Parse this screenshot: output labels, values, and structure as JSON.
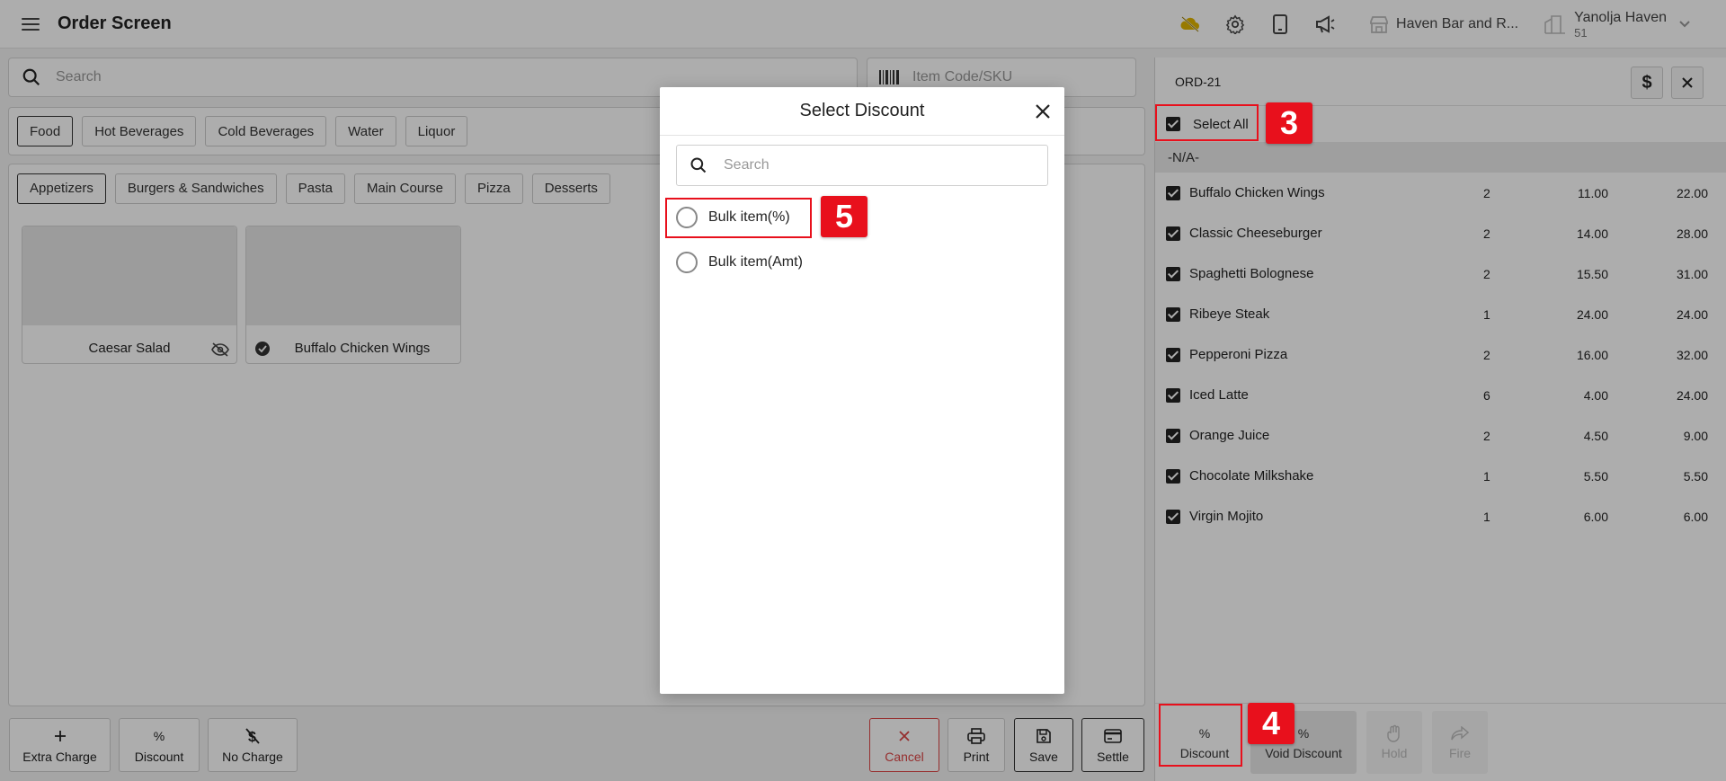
{
  "header": {
    "title": "Order Screen",
    "store_name": "Haven Bar and R...",
    "user_name": "Yanolja Haven",
    "user_sub": "51",
    "icons": [
      "cloud-off-icon",
      "gear-icon",
      "tablet-icon",
      "megaphone-icon"
    ]
  },
  "search": {
    "placeholder": "Search"
  },
  "sku": {
    "placeholder": "Item Code/SKU"
  },
  "categories": [
    "Food",
    "Hot Beverages",
    "Cold Beverages",
    "Water",
    "Liquor"
  ],
  "subcategories": [
    "Appetizers",
    "Burgers & Sandwiches",
    "Pasta",
    "Main Course",
    "Pizza",
    "Desserts"
  ],
  "products": [
    "Caesar Salad",
    "Buffalo Chicken Wings"
  ],
  "bottom_actions": {
    "extra_charge": "Extra Charge",
    "discount": "Discount",
    "no_charge": "No Charge",
    "cancel": "Cancel",
    "print": "Print",
    "save": "Save",
    "settle": "Settle"
  },
  "order": {
    "id": "ORD-21",
    "select_all": "Select All",
    "group": "-N/A-",
    "items": [
      {
        "name": "Buffalo Chicken Wings",
        "qty": "2",
        "price": "11.00",
        "total": "22.00"
      },
      {
        "name": "Classic Cheeseburger",
        "qty": "2",
        "price": "14.00",
        "total": "28.00"
      },
      {
        "name": "Spaghetti Bolognese",
        "qty": "2",
        "price": "15.50",
        "total": "31.00"
      },
      {
        "name": "Ribeye Steak",
        "qty": "1",
        "price": "24.00",
        "total": "24.00"
      },
      {
        "name": "Pepperoni Pizza",
        "qty": "2",
        "price": "16.00",
        "total": "32.00"
      },
      {
        "name": "Iced Latte",
        "qty": "6",
        "price": "4.00",
        "total": "24.00"
      },
      {
        "name": "Orange Juice",
        "qty": "2",
        "price": "4.50",
        "total": "9.00"
      },
      {
        "name": "Chocolate Milkshake",
        "qty": "1",
        "price": "5.50",
        "total": "5.50"
      },
      {
        "name": "Virgin Mojito",
        "qty": "1",
        "price": "6.00",
        "total": "6.00"
      }
    ],
    "actions": {
      "discount": "Discount",
      "void_discount": "Void Discount",
      "hold": "Hold",
      "fire": "Fire"
    }
  },
  "modal": {
    "title": "Select Discount",
    "search_placeholder": "Search",
    "options": [
      "Bulk item(%)",
      "Bulk item(Amt)"
    ]
  },
  "annotations": [
    "3",
    "4",
    "5"
  ],
  "colors": {
    "annotation": "#e8101c"
  }
}
